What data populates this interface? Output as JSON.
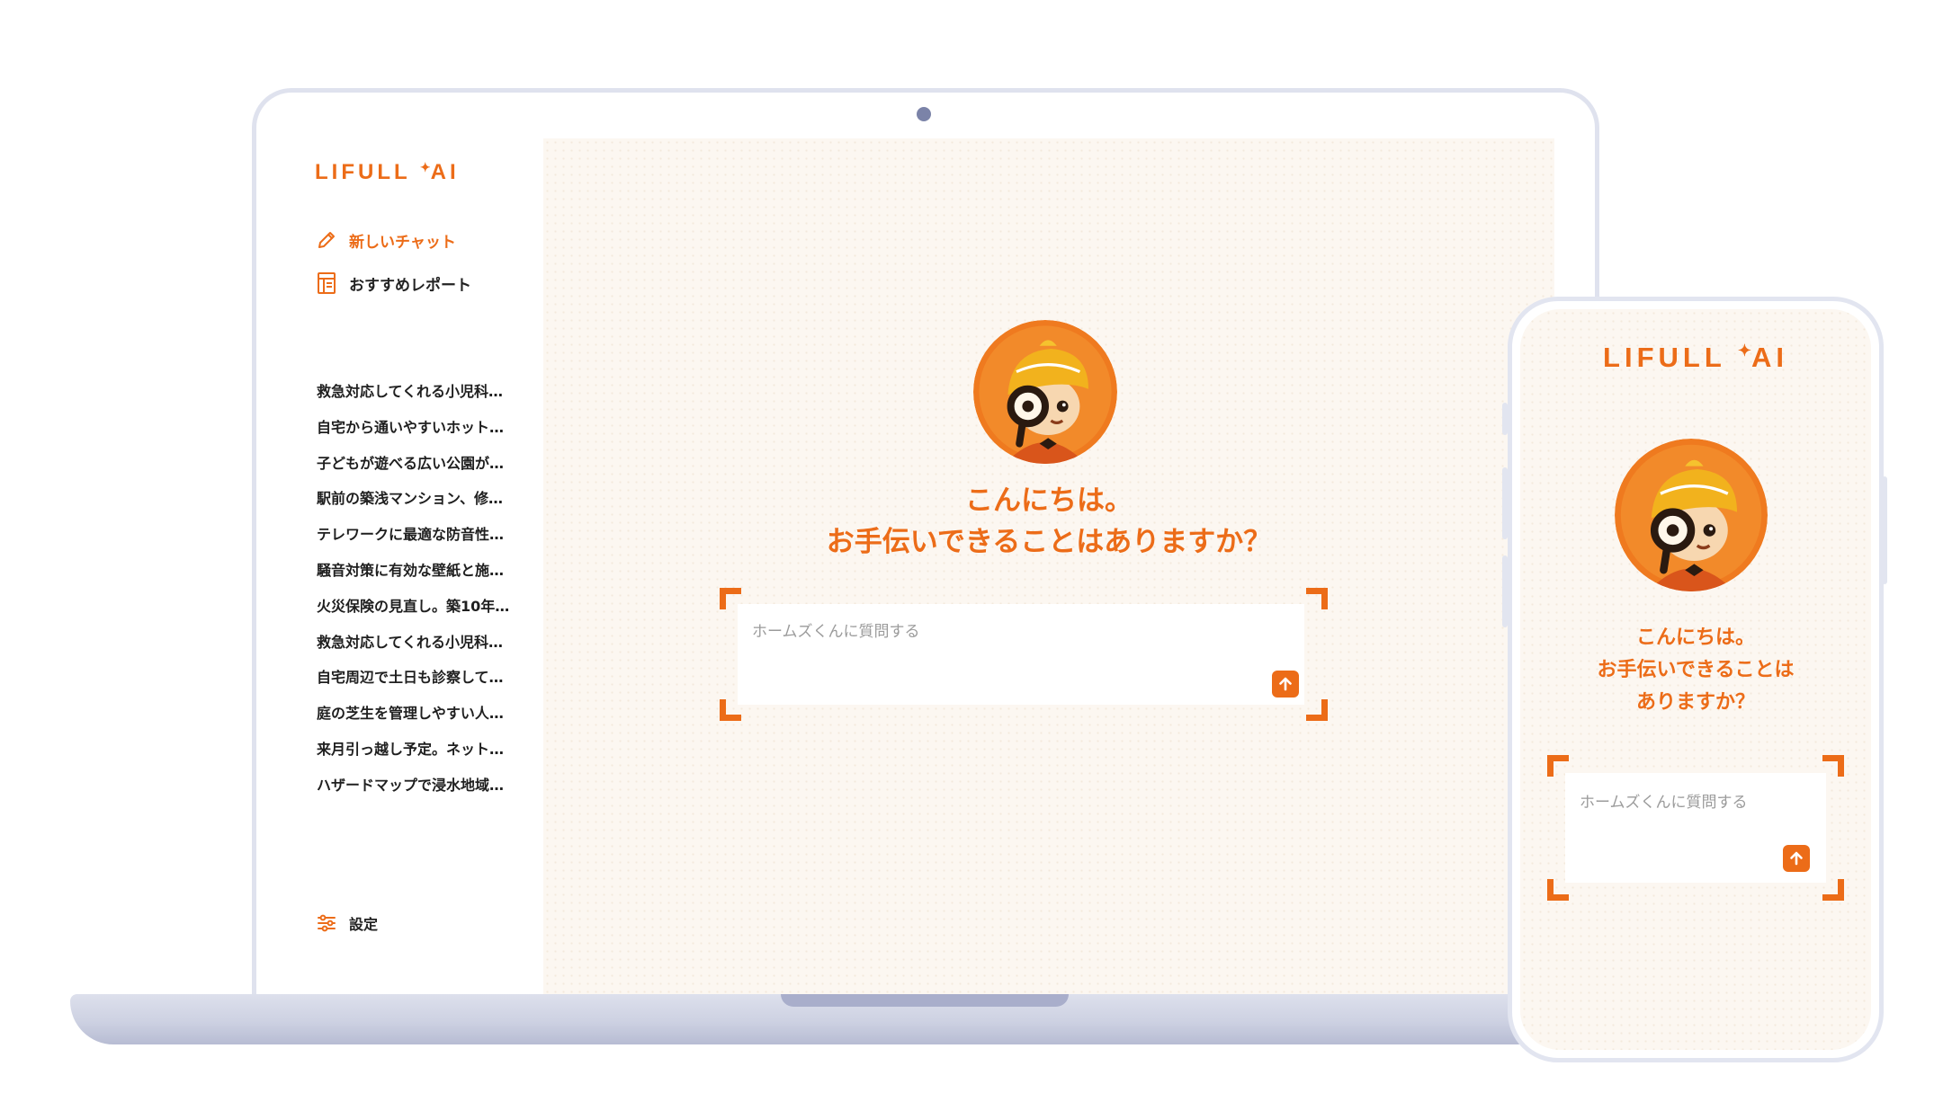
{
  "brand": {
    "logo_text": "LIFULL",
    "logo_spark": "✦",
    "logo_suffix": "AI",
    "accent_color": "#ec6c18"
  },
  "sidebar": {
    "new_chat_label": "新しいチャット",
    "new_chat_icon": "pencil-icon",
    "report_label": "おすすめレポート",
    "report_icon": "report-icon",
    "history": [
      "救急対応してくれる小児科…",
      "自宅から通いやすいホット…",
      "子どもが遊べる広い公園が…",
      "駅前の築浅マンション、修…",
      "テレワークに最適な防音性…",
      "騒音対策に有効な壁紙と施…",
      "火災保険の見直し。築10年…",
      "救急対応してくれる小児科…",
      "自宅周辺で土日も診察して…",
      "庭の芝生を管理しやすい人…",
      "来月引っ越し予定。ネット…",
      "ハザードマップで浸水地域…"
    ],
    "settings_label": "設定",
    "settings_icon": "sliders-icon"
  },
  "chat": {
    "greeting_line1": "こんにちは。",
    "greeting_line2": "お手伝いできることはありますか？",
    "input_placeholder": "ホームズくんに質問する",
    "send_icon": "arrow-up-icon"
  },
  "phone": {
    "greeting_line1": "こんにちは。",
    "greeting_line2": "お手伝いできることは",
    "greeting_line3": "ありますか？",
    "input_placeholder": "ホームズくんに質問する"
  }
}
